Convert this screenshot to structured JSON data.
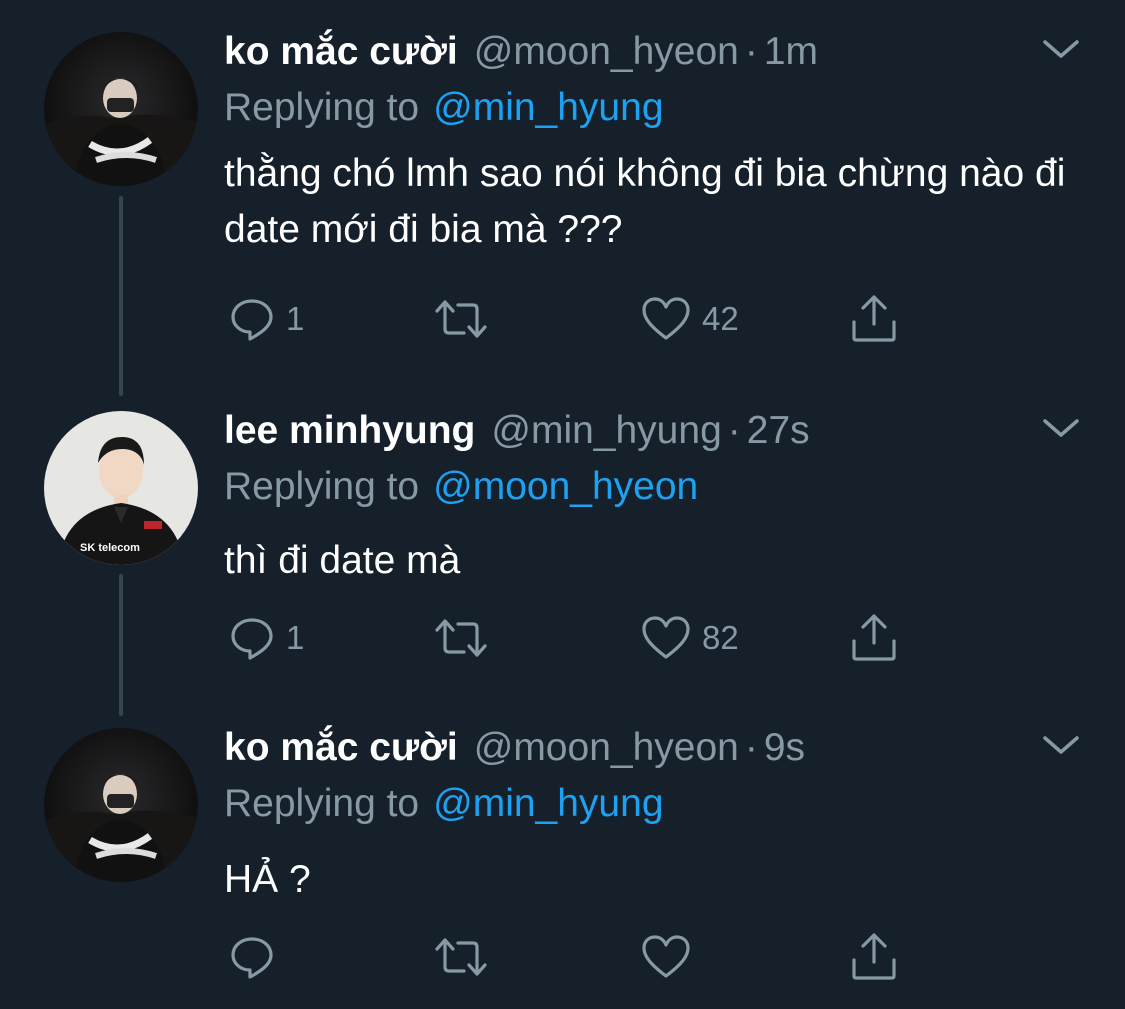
{
  "colors": {
    "background": "#15202b",
    "text": "#ffffff",
    "muted": "#8899a6",
    "link": "#1da1f2",
    "thread_line": "#38444d"
  },
  "tweets": [
    {
      "display_name": "ko mắc cười",
      "handle": "@moon_hyeon",
      "separator": "·",
      "time": "1m",
      "reply_prefix": "Replying to",
      "reply_to": "@min_hyung",
      "text": "thằng chó lmh sao nói không đi bia chừng nào đi date mới đi bia mà ???",
      "replies": "1",
      "retweets": "",
      "likes": "42",
      "avatar_icon": "user-avatar-dark-photo-icon"
    },
    {
      "display_name": "lee minhyung",
      "handle": "@min_hyung",
      "separator": "·",
      "time": "27s",
      "reply_prefix": "Replying to",
      "reply_to": "@moon_hyeon",
      "text": "thì đi date mà",
      "replies": "1",
      "retweets": "",
      "likes": "82",
      "avatar_icon": "user-avatar-jersey-photo-icon",
      "avatar_jersey_text": "SK telecom"
    },
    {
      "display_name": "ko mắc cười",
      "handle": "@moon_hyeon",
      "separator": "·",
      "time": "9s",
      "reply_prefix": "Replying to",
      "reply_to": "@min_hyung",
      "text": "HẢ ?",
      "replies": "",
      "retweets": "",
      "likes": "",
      "avatar_icon": "user-avatar-dark-photo-icon"
    }
  ]
}
